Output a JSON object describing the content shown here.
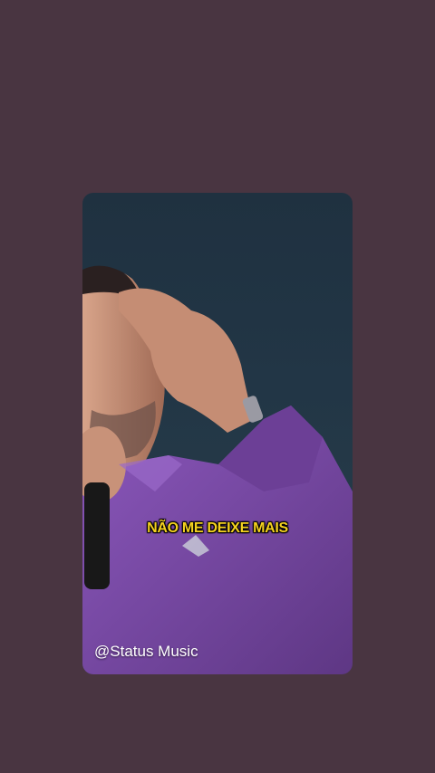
{
  "video": {
    "subtitle": "NÃO ME DEIXE MAIS",
    "watermark": "@Status Music"
  },
  "colors": {
    "background": "#493541",
    "subtitle": "#f5d21f",
    "shirt": "#7b4aa8"
  }
}
